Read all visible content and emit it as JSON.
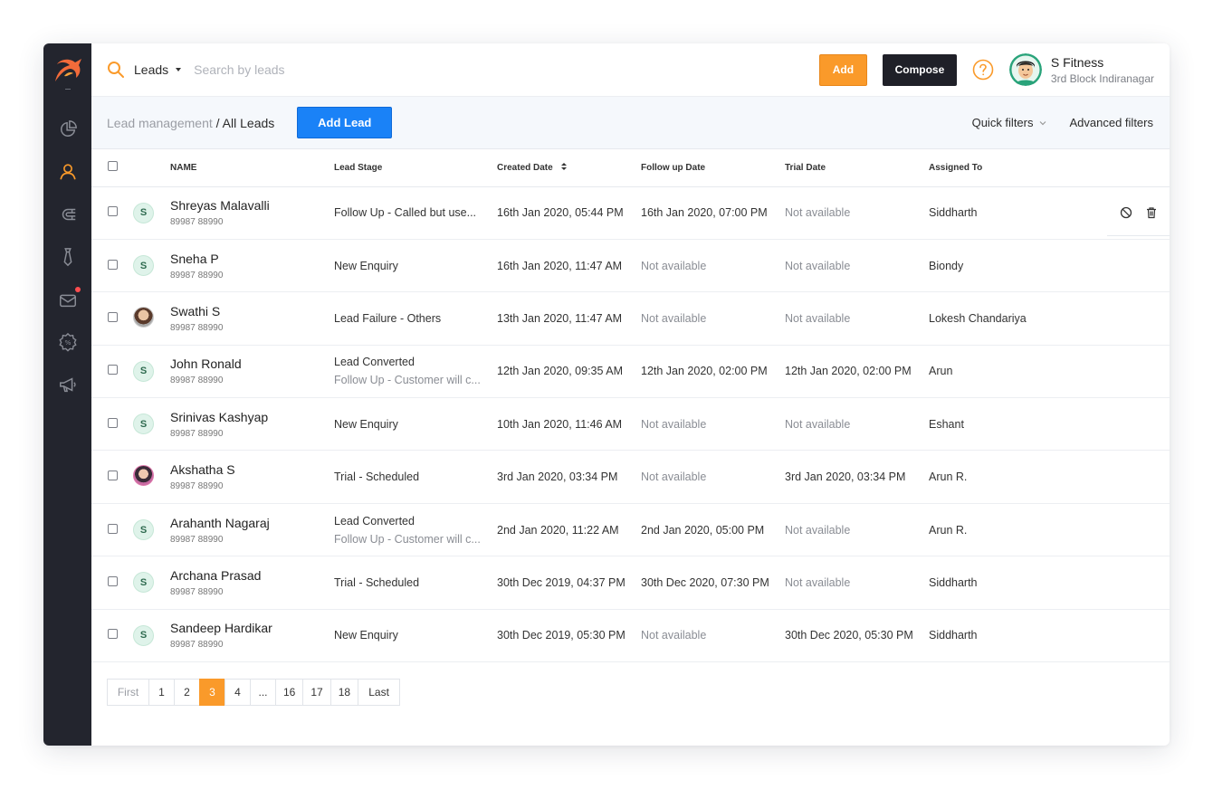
{
  "colors": {
    "accent_orange": "#fa9a2a",
    "primary_blue": "#1a82f7",
    "sidebar_bg": "#23252e",
    "compose_bg": "#1f2028"
  },
  "sidebar": {
    "items": [
      {
        "name": "dashboard",
        "icon": "pie-chart-icon",
        "active": false
      },
      {
        "name": "leads",
        "icon": "user-icon",
        "active": true
      },
      {
        "name": "magnet",
        "icon": "magnet-icon",
        "active": false
      },
      {
        "name": "staff",
        "icon": "tie-icon",
        "active": false
      },
      {
        "name": "inbox",
        "icon": "inbox-icon",
        "active": false,
        "notification": true
      },
      {
        "name": "offers",
        "icon": "discount-badge-icon",
        "active": false
      },
      {
        "name": "campaigns",
        "icon": "megaphone-icon",
        "active": false
      }
    ]
  },
  "topbar": {
    "scope": "Leads",
    "search_placeholder": "Search by leads",
    "add_label": "Add",
    "compose_label": "Compose",
    "org_name": "S Fitness",
    "org_location": "3rd Block Indiranagar"
  },
  "subbar": {
    "breadcrumb_parent": "Lead management",
    "breadcrumb_sep": " / ",
    "breadcrumb_current": "All Leads",
    "add_lead_label": "Add Lead",
    "quick_filters": "Quick filters",
    "advanced_filters": "Advanced filters"
  },
  "table": {
    "headers": {
      "name": "NAME",
      "stage": "Lead Stage",
      "created": "Created Date",
      "followup": "Follow up Date",
      "trial": "Trial Date",
      "assigned": "Assigned To"
    },
    "rows": [
      {
        "avatar": "S",
        "name": "Shreyas Malavalli",
        "phone": "89987 88990",
        "stage": "Follow Up - Called but use...",
        "stage2": "",
        "created": "16th Jan 2020, 05:44 PM",
        "followup": "16th Jan 2020, 07:00 PM",
        "trial": "Not available",
        "assigned": "Siddharth"
      },
      {
        "avatar": "S",
        "name": "Sneha P",
        "phone": "89987 88990",
        "stage": "New Enquiry",
        "stage2": "",
        "created": "16th Jan 2020, 11:47 AM",
        "followup": "Not available",
        "trial": "Not available",
        "assigned": "Biondy"
      },
      {
        "avatar": "",
        "name": "Swathi S",
        "phone": "89987 88990",
        "stage": "Lead Failure - Others",
        "stage2": "",
        "created": "13th Jan 2020, 11:47 AM",
        "followup": "Not available",
        "trial": "Not available",
        "assigned": "Lokesh Chandariya"
      },
      {
        "avatar": "S",
        "name": "John Ronald",
        "phone": "89987 88990",
        "stage": "Lead Converted",
        "stage2": "Follow Up - Customer will c...",
        "created": "12th Jan 2020, 09:35 AM",
        "followup": "12th Jan 2020, 02:00 PM",
        "trial": "12th Jan 2020, 02:00 PM",
        "assigned": "Arun"
      },
      {
        "avatar": "S",
        "name": "Srinivas Kashyap",
        "phone": "89987 88990",
        "stage": "New Enquiry",
        "stage2": "",
        "created": "10th Jan 2020, 11:46 AM",
        "followup": "Not available",
        "trial": "Not available",
        "assigned": "Eshant"
      },
      {
        "avatar": "",
        "name": "Akshatha S",
        "phone": "89987 88990",
        "stage": "Trial - Scheduled",
        "stage2": "",
        "created": "3rd Jan 2020, 03:34 PM",
        "followup": "Not available",
        "trial": "3rd Jan 2020, 03:34 PM",
        "assigned": "Arun R."
      },
      {
        "avatar": "S",
        "name": "Arahanth Nagaraj",
        "phone": "89987 88990",
        "stage": "Lead Converted",
        "stage2": "Follow Up - Customer will c...",
        "created": "2nd Jan 2020, 11:22 AM",
        "followup": "2nd Jan 2020, 05:00 PM",
        "trial": "Not available",
        "assigned": "Arun R."
      },
      {
        "avatar": "S",
        "name": "Archana Prasad",
        "phone": "89987 88990",
        "stage": "Trial - Scheduled",
        "stage2": "",
        "created": "30th Dec 2019, 04:37 PM",
        "followup": "30th Dec 2020, 07:30 PM",
        "trial": "Not available",
        "assigned": "Siddharth"
      },
      {
        "avatar": "S",
        "name": "Sandeep Hardikar",
        "phone": "89987 88990",
        "stage": "New Enquiry",
        "stage2": "",
        "created": "30th Dec 2019, 05:30 PM",
        "followup": "Not available",
        "trial": "30th Dec 2020, 05:30 PM",
        "assigned": "Siddharth"
      }
    ]
  },
  "pagination": {
    "pages": [
      "First",
      "1",
      "2",
      "3",
      "4",
      "...",
      "16",
      "17",
      "18",
      "Last"
    ],
    "current": "3"
  }
}
